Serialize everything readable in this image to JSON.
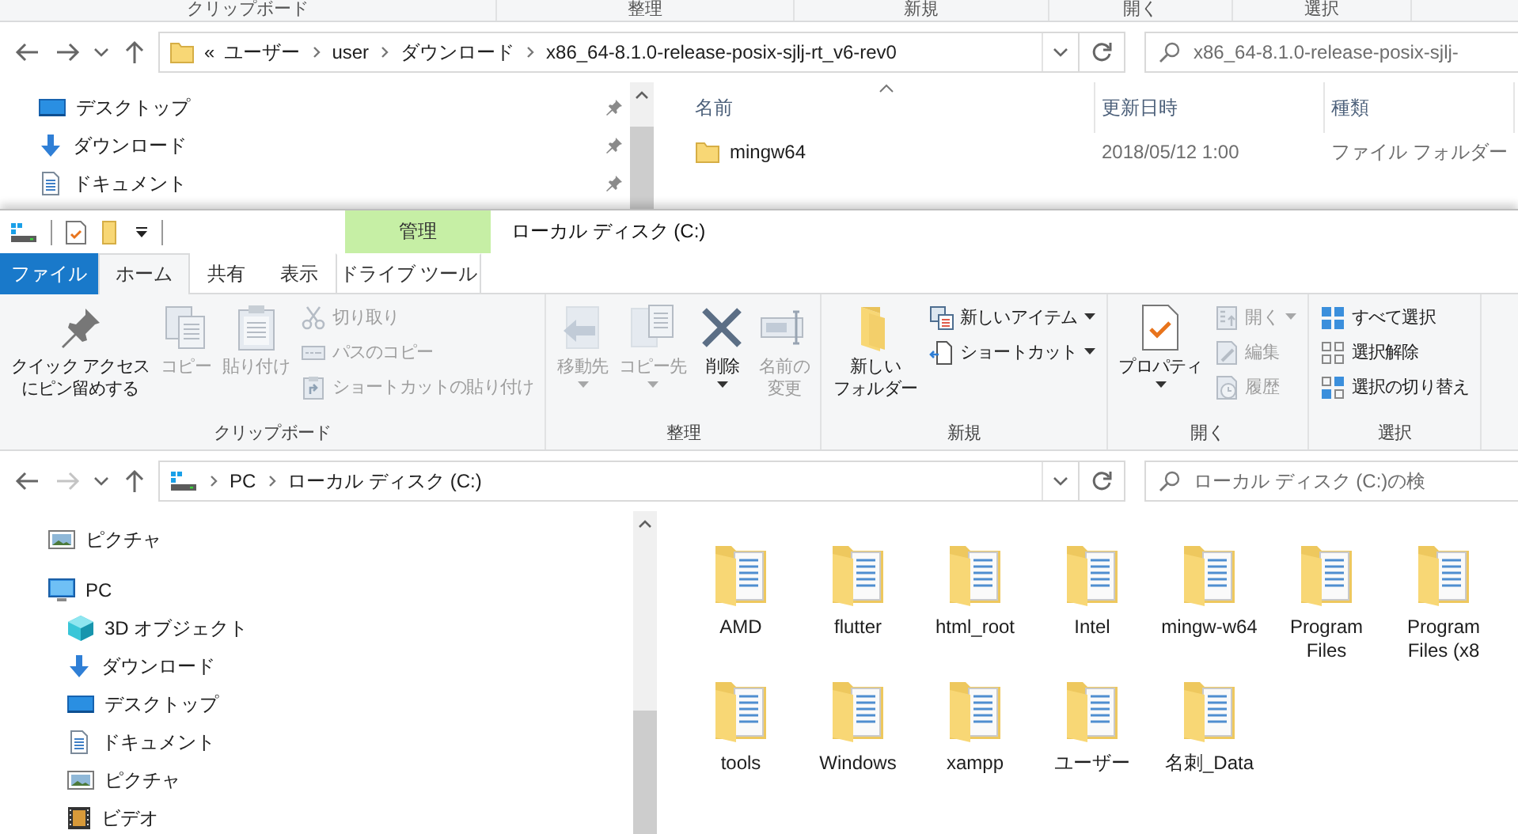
{
  "back_window": {
    "ribbon_group_labels": [
      "クリップボード",
      "整理",
      "新規",
      "開く",
      "選択"
    ],
    "nav_buttons": {
      "back_disabled": false,
      "forward_disabled": false
    },
    "address_bar": {
      "overflow": "«",
      "path": [
        "ユーザー",
        "user",
        "ダウンロード",
        "x86_64-8.1.0-release-posix-sjlj-rt_v6-rev0"
      ]
    },
    "search": {
      "placeholder": "x86_64-8.1.0-release-posix-sjlj-"
    },
    "nav_pane": [
      {
        "label": "デスクトップ",
        "pinned": true
      },
      {
        "label": "ダウンロード",
        "pinned": true
      },
      {
        "label": "ドキュメント",
        "pinned": true
      }
    ],
    "file_list": {
      "columns": [
        {
          "label": "名前",
          "sorted": true
        },
        {
          "label": "更新日時",
          "sorted": false
        },
        {
          "label": "種類",
          "sorted": false
        }
      ],
      "rows": [
        {
          "name": "mingw64",
          "modified": "2018/05/12 1:00",
          "type": "ファイル フォルダー"
        }
      ]
    }
  },
  "window": {
    "title": "ローカル ディスク (C:)",
    "context_group": "管理",
    "tabs": [
      {
        "label": "ファイル",
        "kind": "file",
        "selected": false
      },
      {
        "label": "ホーム",
        "kind": "tab",
        "selected": true
      },
      {
        "label": "共有",
        "kind": "tab",
        "selected": false
      },
      {
        "label": "表示",
        "kind": "tab",
        "selected": false
      },
      {
        "label": "ドライブ ツール",
        "kind": "context",
        "selected": false
      }
    ],
    "ribbon": {
      "groups": [
        {
          "label": "クリップボード",
          "buttons": [
            {
              "lines": [
                "クイック アクセス",
                "にピン留めする"
              ],
              "kind": "large",
              "disabled": false,
              "dropdown": false
            },
            {
              "lines": [
                "コピー"
              ],
              "kind": "large",
              "disabled": true,
              "dropdown": false
            },
            {
              "lines": [
                "貼り付け"
              ],
              "kind": "large",
              "disabled": true,
              "dropdown": false
            },
            {
              "lines": [
                "切り取り"
              ],
              "kind": "small",
              "disabled": true,
              "dropdown": false
            },
            {
              "lines": [
                "パスのコピー"
              ],
              "kind": "small",
              "disabled": true,
              "dropdown": false
            },
            {
              "lines": [
                "ショートカットの貼り付け"
              ],
              "kind": "small",
              "disabled": true,
              "dropdown": false
            }
          ]
        },
        {
          "label": "整理",
          "buttons": [
            {
              "lines": [
                "移動先"
              ],
              "kind": "large",
              "disabled": true,
              "dropdown": true
            },
            {
              "lines": [
                "コピー先"
              ],
              "kind": "large",
              "disabled": true,
              "dropdown": true
            },
            {
              "lines": [
                "削除"
              ],
              "kind": "large",
              "disabled": false,
              "dropdown": true
            },
            {
              "lines": [
                "名前の",
                "変更"
              ],
              "kind": "large",
              "disabled": true,
              "dropdown": false
            }
          ]
        },
        {
          "label": "新規",
          "buttons": [
            {
              "lines": [
                "新しい",
                "フォルダー"
              ],
              "kind": "large",
              "disabled": false,
              "dropdown": false
            },
            {
              "lines": [
                "新しいアイテム"
              ],
              "kind": "small",
              "disabled": false,
              "dropdown": true
            },
            {
              "lines": [
                "ショートカット"
              ],
              "kind": "small",
              "disabled": false,
              "dropdown": true
            }
          ]
        },
        {
          "label": "開く",
          "buttons": [
            {
              "lines": [
                "プロパティ"
              ],
              "kind": "large",
              "disabled": false,
              "dropdown": true
            },
            {
              "lines": [
                "開く"
              ],
              "kind": "small",
              "disabled": true,
              "dropdown": true
            },
            {
              "lines": [
                "編集"
              ],
              "kind": "small",
              "disabled": true,
              "dropdown": false
            },
            {
              "lines": [
                "履歴"
              ],
              "kind": "small",
              "disabled": true,
              "dropdown": false
            }
          ]
        },
        {
          "label": "選択",
          "buttons": [
            {
              "lines": [
                "すべて選択"
              ],
              "kind": "small",
              "disabled": false,
              "dropdown": false
            },
            {
              "lines": [
                "選択解除"
              ],
              "kind": "small",
              "disabled": false,
              "dropdown": false
            },
            {
              "lines": [
                "選択の切り替え"
              ],
              "kind": "small",
              "disabled": false,
              "dropdown": false
            }
          ]
        }
      ]
    },
    "nav_buttons": {
      "back_disabled": false,
      "forward_disabled": true
    },
    "address_bar": {
      "path": [
        "PC",
        "ローカル ディスク (C:)"
      ]
    },
    "search": {
      "placeholder": "ローカル ディスク (C:)の検"
    },
    "nav_pane": [
      {
        "label": "ピクチャ"
      },
      {
        "label": "PC",
        "children": [
          {
            "label": "3D オブジェクト"
          },
          {
            "label": "ダウンロード"
          },
          {
            "label": "デスクトップ"
          },
          {
            "label": "ドキュメント"
          },
          {
            "label": "ピクチャ"
          },
          {
            "label": "ビデオ"
          }
        ]
      }
    ],
    "items": [
      {
        "name": "AMD"
      },
      {
        "name": "flutter"
      },
      {
        "name": "html_root"
      },
      {
        "name": "Intel"
      },
      {
        "name": "mingw-w64"
      },
      {
        "name": "Program Files"
      },
      {
        "name": "Program Files (x8"
      },
      {
        "name": "tools"
      },
      {
        "name": "Windows"
      },
      {
        "name": "xampp"
      },
      {
        "name": "ユーザー"
      },
      {
        "name": "名刺_Data"
      }
    ]
  }
}
